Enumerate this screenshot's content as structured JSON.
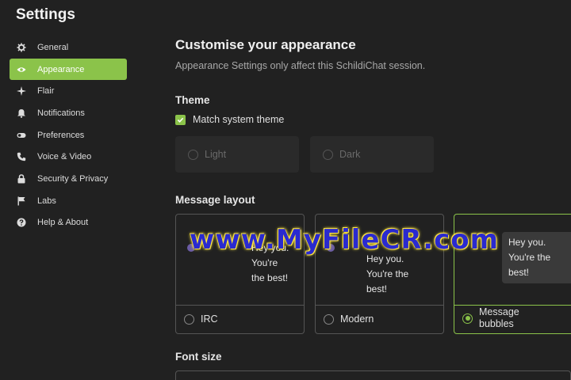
{
  "page": {
    "title": "Settings"
  },
  "sidebar": {
    "items": [
      {
        "label": "General",
        "icon": "gear-icon"
      },
      {
        "label": "Appearance",
        "icon": "eye-icon",
        "active": true
      },
      {
        "label": "Flair",
        "icon": "sparkle-icon"
      },
      {
        "label": "Notifications",
        "icon": "bell-icon"
      },
      {
        "label": "Preferences",
        "icon": "toggle-icon"
      },
      {
        "label": "Voice & Video",
        "icon": "phone-icon"
      },
      {
        "label": "Security & Privacy",
        "icon": "lock-icon"
      },
      {
        "label": "Labs",
        "icon": "flag-icon"
      },
      {
        "label": "Help & About",
        "icon": "help-icon"
      }
    ]
  },
  "main": {
    "heading": "Customise your appearance",
    "subheading": "Appearance Settings only affect this SchildiChat session.",
    "theme": {
      "heading": "Theme",
      "match_system_label": "Match system theme",
      "match_system_checked": true,
      "options": [
        "Light",
        "Dark"
      ]
    },
    "layout": {
      "heading": "Message layout",
      "preview_lines": [
        "Hey you.",
        "You're",
        "the best!"
      ],
      "preview_lines_bubble": [
        "Hey you.",
        "You're the",
        "best!"
      ],
      "options": [
        {
          "label": "IRC",
          "selected": false
        },
        {
          "label": "Modern",
          "selected": false
        },
        {
          "label": "Message bubbles",
          "selected": true
        }
      ]
    },
    "font": {
      "heading": "Font size"
    }
  },
  "watermark": {
    "text": "www.MyFileCR.com"
  },
  "colors": {
    "accent": "#8bc34a",
    "background": "#212121",
    "card_border": "#555555"
  }
}
